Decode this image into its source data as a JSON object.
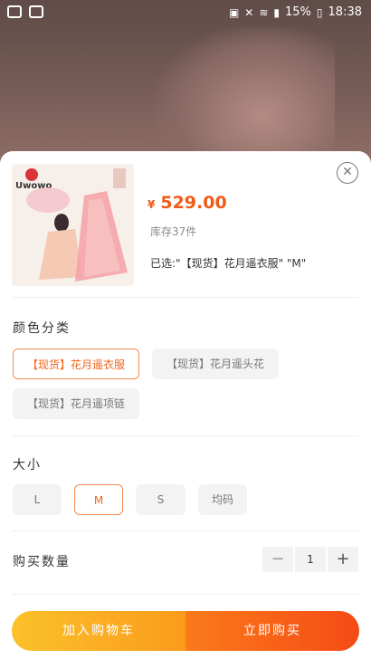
{
  "status": {
    "battery_pct": "15%",
    "time": "18:38"
  },
  "product": {
    "currency": "¥",
    "price": "529.00",
    "stock": "库存37件",
    "selected_text": "已选:\"【现货】花月遥衣服\" \"M\"",
    "thumb_logo": "Uwowo"
  },
  "color_section": {
    "title": "颜色分类",
    "options": [
      "【现货】花月遥衣服",
      "【现货】花月遥头花",
      "【现货】花月遥项链"
    ],
    "selected_index": 0
  },
  "size_section": {
    "title": "大小",
    "options": [
      "L",
      "M",
      "S",
      "均码"
    ],
    "selected_index": 1
  },
  "quantity": {
    "label": "购买数量",
    "minus": "−",
    "value": "1",
    "plus": "+"
  },
  "actions": {
    "add_to_cart": "加入购物车",
    "buy_now": "立即购买"
  },
  "close_icon": "close-icon"
}
